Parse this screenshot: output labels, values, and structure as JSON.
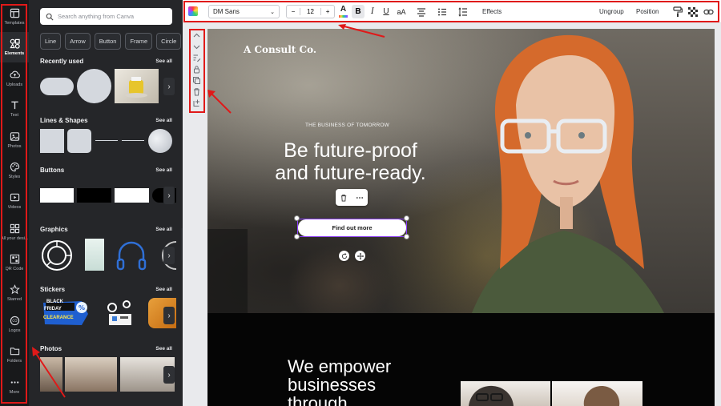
{
  "rail": {
    "items": [
      {
        "label": "Templates",
        "icon": "templates-icon"
      },
      {
        "label": "Elements",
        "icon": "elements-icon"
      },
      {
        "label": "Uploads",
        "icon": "upload-cloud-icon"
      },
      {
        "label": "Text",
        "icon": "text-icon"
      },
      {
        "label": "Photos",
        "icon": "photo-icon"
      },
      {
        "label": "Styles",
        "icon": "palette-icon"
      },
      {
        "label": "Videos",
        "icon": "video-icon"
      },
      {
        "label": "All your desi...",
        "icon": "grid-apps-icon"
      },
      {
        "label": "QR Code",
        "icon": "qr-code-icon"
      },
      {
        "label": "Starred",
        "icon": "star-icon"
      },
      {
        "label": "Logos",
        "icon": "logo-icon"
      },
      {
        "label": "Folders",
        "icon": "folder-icon"
      },
      {
        "label": "More",
        "icon": "more-icon"
      }
    ]
  },
  "panel": {
    "search_placeholder": "Search anything from Canva",
    "chips": [
      "Line",
      "Arrow",
      "Button",
      "Frame",
      "Circle"
    ],
    "sections": {
      "recently_used": "Recently used",
      "lines_shapes": "Lines & Shapes",
      "buttons": "Buttons",
      "graphics": "Graphics",
      "stickers": "Stickers",
      "photos": "Photos"
    },
    "see_all": "See all",
    "sticker_text_1": "BLACK",
    "sticker_text_2": "FRIDAY",
    "sticker_text_3": "CLEARANCE"
  },
  "toolbar": {
    "font": "DM Sans",
    "font_size": "12",
    "minus": "−",
    "plus": "+",
    "bold": "B",
    "italic": "I",
    "underline": "U",
    "case": "aA",
    "effects": "Effects",
    "ungroup": "Ungroup",
    "position": "Position"
  },
  "canvas": {
    "brand": "A Consult Co.",
    "tagline": "THE BUSINESS OF TOMORROW",
    "headline": "Be future-proof and future-ready.",
    "cta": "Find out more",
    "empower_line1": "We empower",
    "empower_line2": "businesses",
    "empower_line3": "through"
  },
  "colors": {
    "accent": "#8b3dff",
    "annotation": "#e01919",
    "panel_bg": "#252629",
    "rail_bg": "#18191b"
  }
}
